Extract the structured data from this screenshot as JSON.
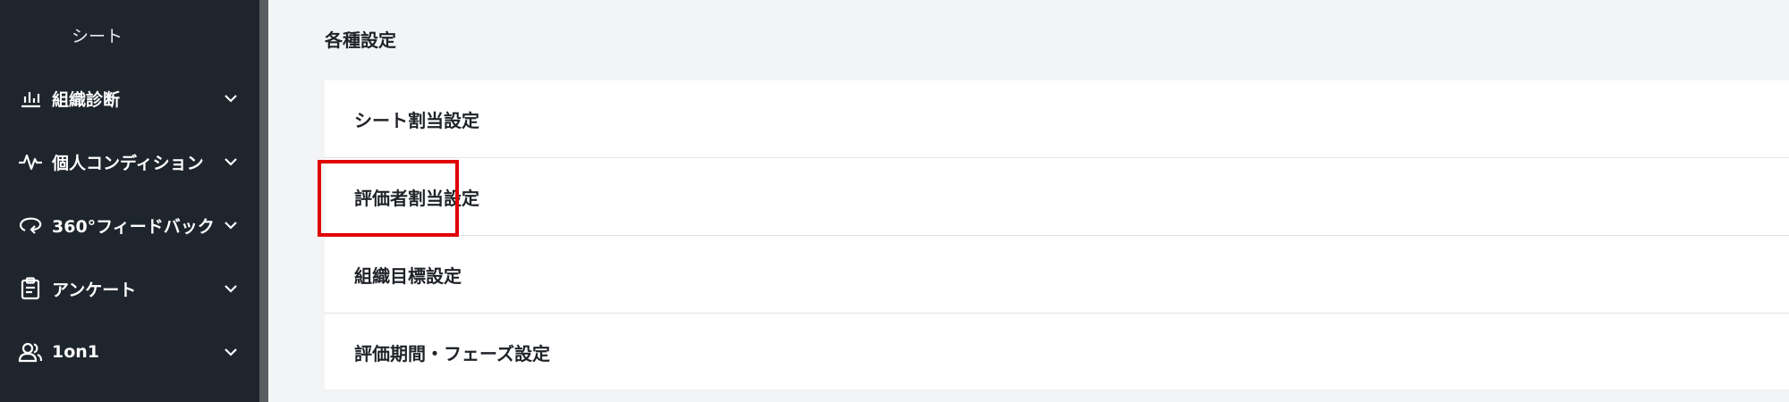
{
  "sidebar": {
    "sub_item": "シート",
    "items": [
      {
        "label": "組織診断",
        "icon": "bar-chart-icon"
      },
      {
        "label": "個人コンディション",
        "icon": "pulse-icon"
      },
      {
        "label": "360°フィードバック",
        "icon": "feedback-loop-icon"
      },
      {
        "label": "アンケート",
        "icon": "clipboard-icon"
      },
      {
        "label": "1on1",
        "icon": "users-icon"
      }
    ]
  },
  "main": {
    "section_title": "各種設定",
    "settings": [
      {
        "label": "シート割当設定"
      },
      {
        "label": "評価者割当設定"
      },
      {
        "label": "組織目標設定"
      },
      {
        "label": "評価期間・フェーズ設定"
      }
    ],
    "highlighted_item": "評価者割当設定"
  },
  "colors": {
    "sidebar_bg": "#1e252d",
    "page_bg": "#f3f4f6",
    "card_bg": "#ffffff",
    "highlight": "#e10000"
  }
}
